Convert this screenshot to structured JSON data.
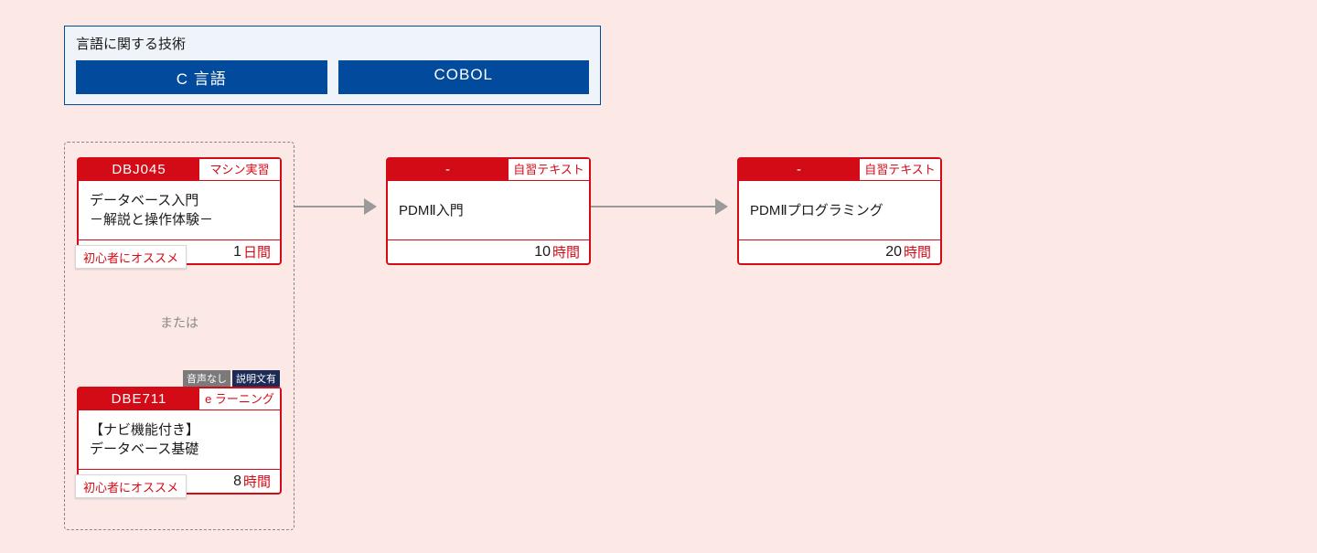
{
  "header": {
    "title": "言語に関する技術",
    "tabs": [
      "C 言語",
      "COBOL"
    ]
  },
  "group": {
    "or": "または"
  },
  "cards": {
    "c1": {
      "code": "DBJ045",
      "tag": "マシン実習",
      "title": "データベース入門\n－解説と操作体験－",
      "durationNum": "1",
      "durationUnit": "日間",
      "recommend": "初心者にオススメ"
    },
    "c2": {
      "code": "DBE711",
      "tag": "e ラーニング",
      "title": "【ナビ機能付き】\nデータベース基礎",
      "durationNum": "8",
      "durationUnit": "時間",
      "recommend": "初心者にオススメ",
      "miniTags": [
        "音声なし",
        "説明文有"
      ]
    },
    "c3": {
      "code": "-",
      "tag": "自習テキスト",
      "title": "PDMⅡ入門",
      "durationNum": "10",
      "durationUnit": "時間"
    },
    "c4": {
      "code": "-",
      "tag": "自習テキスト",
      "title": "PDMⅡプログラミング",
      "durationNum": "20",
      "durationUnit": "時間"
    }
  }
}
